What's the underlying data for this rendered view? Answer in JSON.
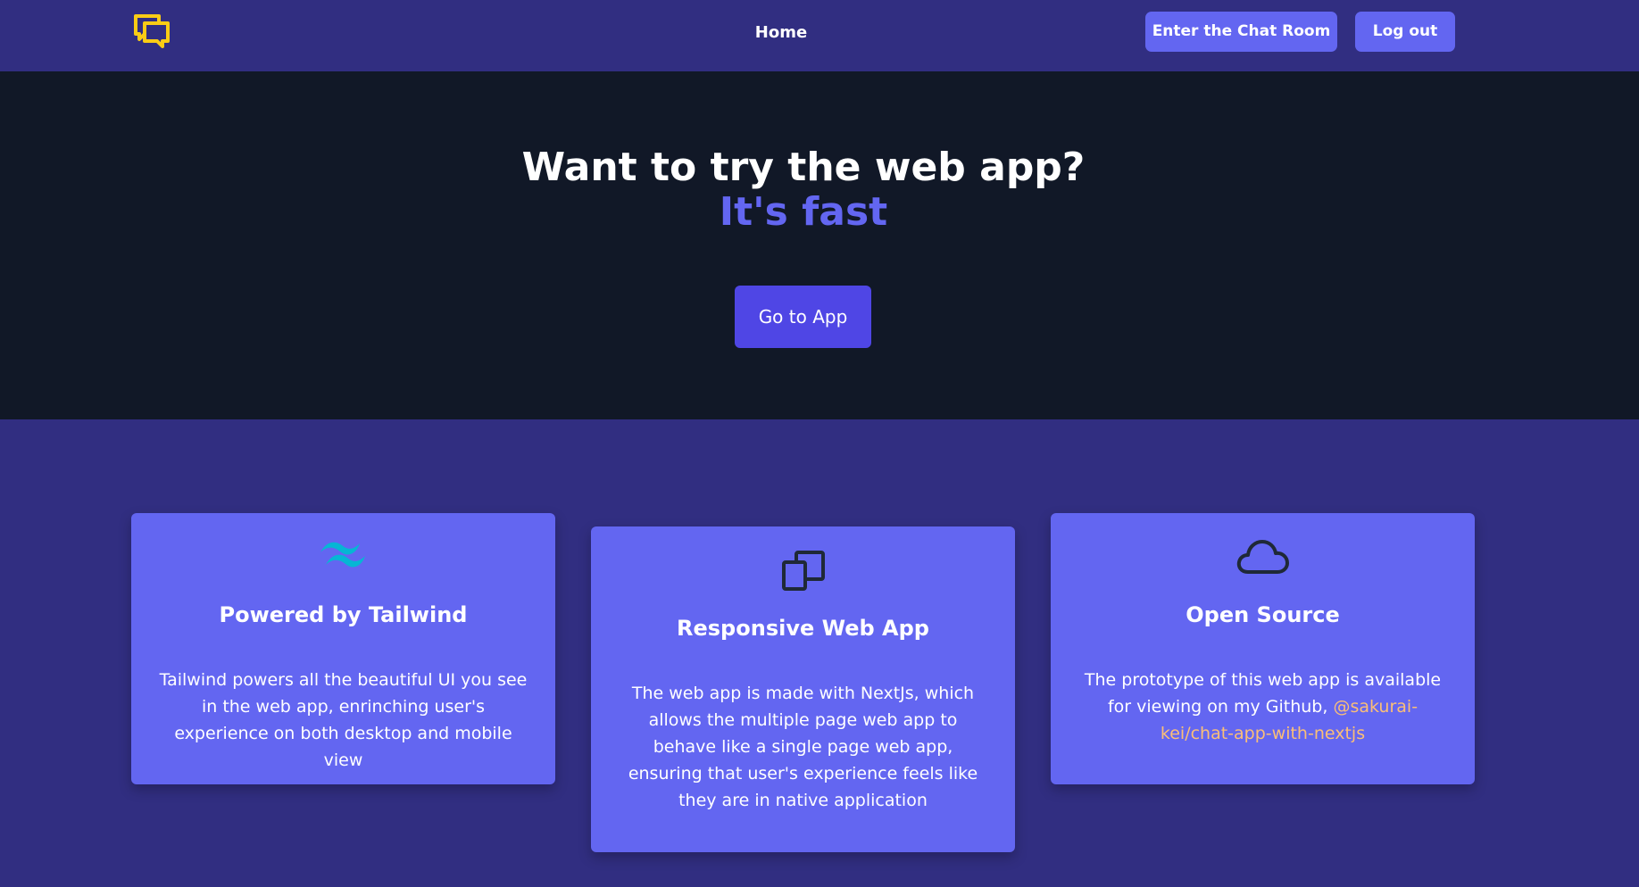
{
  "nav": {
    "logo_icon": "chat-bubbles-icon",
    "home_label": "Home",
    "chat_button_label": "Enter the Chat Room",
    "logout_button_label": "Log out"
  },
  "hero": {
    "title": "Want to try the web app?",
    "subtitle": "It's fast",
    "button_label": "Go to App"
  },
  "features": [
    {
      "icon": "tailwind-logo-icon",
      "title": "Powered by Tailwind",
      "text": "Tailwind powers all the beautiful UI you see in the web app, enrinching user's experience on both desktop and mobile view"
    },
    {
      "icon": "devices-icon",
      "title": "Responsive Web App",
      "text": "The web app is made with NextJs, which allows the multiple page web app to behave like a single page web app, ensuring that user's experience feels like they are in native application"
    },
    {
      "icon": "cloud-icon",
      "title": "Open Source",
      "text_prefix": "The prototype of this web app is available for viewing on my Github, ",
      "link_text": "@sakurai-kei/chat-app-with-nextjs"
    }
  ],
  "colors": {
    "nav_bg": "#312e81",
    "hero_bg": "#111827",
    "accent": "#6366f1",
    "button": "#4f46e5",
    "logo": "#facc15",
    "link": "#fbbf77"
  }
}
